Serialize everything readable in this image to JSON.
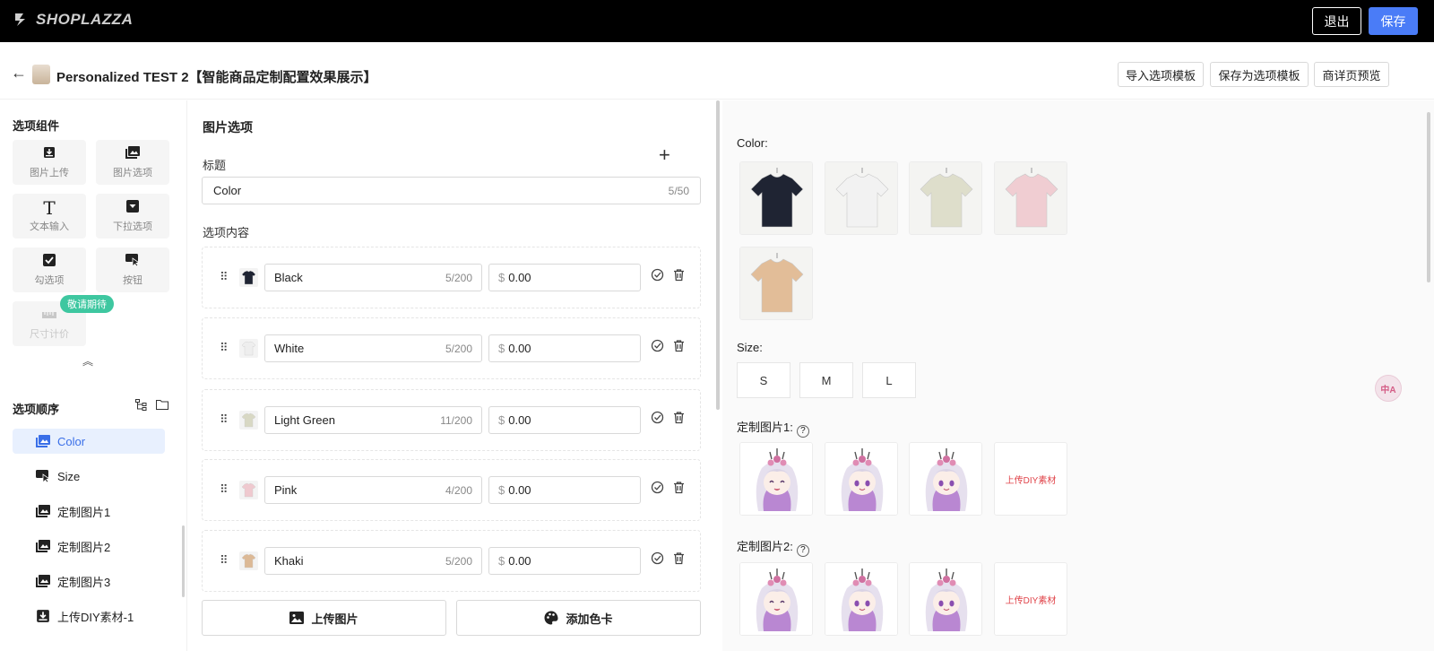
{
  "topbar": {
    "brand": "SHOPLAZZA",
    "exit_label": "退出",
    "save_label": "保存"
  },
  "header": {
    "title": "Personalized TEST 2【智能商品定制配置效果展示】",
    "import_template": "导入选项模板",
    "save_template": "保存为选项模板",
    "preview": "商详页预览"
  },
  "components": {
    "title": "选项组件",
    "items": [
      {
        "label": "图片上传",
        "icon": "image-upload-icon"
      },
      {
        "label": "图片选项",
        "icon": "image-option-icon"
      },
      {
        "label": "文本输入",
        "icon": "text-input-icon"
      },
      {
        "label": "下拉选项",
        "icon": "dropdown-icon"
      },
      {
        "label": "勾选项",
        "icon": "checkbox-icon"
      },
      {
        "label": "按钮",
        "icon": "button-cursor-icon"
      },
      {
        "label": "尺寸计价",
        "icon": "ruler-icon",
        "disabled": true
      }
    ],
    "coming_soon": "敬请期待"
  },
  "order": {
    "title": "选项顺序",
    "items": [
      {
        "label": "Color",
        "active": true
      },
      {
        "label": "Size"
      },
      {
        "label": "定制图片1"
      },
      {
        "label": "定制图片2"
      },
      {
        "label": "定制图片3"
      },
      {
        "label": "上传DIY素材-1"
      }
    ]
  },
  "editor": {
    "section_title": "图片选项",
    "title_label": "标题",
    "title_value": "Color",
    "title_counter": "5/50",
    "options_label": "选项内容",
    "options": [
      {
        "name": "Black",
        "counter": "5/200",
        "currency": "$",
        "price": "0.00",
        "color": "#1f2433"
      },
      {
        "name": "White",
        "counter": "5/200",
        "currency": "$",
        "price": "0.00",
        "color": "#eeeeee"
      },
      {
        "name": "Light Green",
        "counter": "11/200",
        "currency": "$",
        "price": "0.00",
        "color": "#d8d8c4"
      },
      {
        "name": "Pink",
        "counter": "4/200",
        "currency": "$",
        "price": "0.00",
        "color": "#efc9cf"
      },
      {
        "name": "Khaki",
        "counter": "5/200",
        "currency": "$",
        "price": "0.00",
        "color": "#dcb996"
      }
    ],
    "upload_image": "上传图片",
    "add_color_card": "添加色卡"
  },
  "preview": {
    "color_label": "Color:",
    "color_swatches": [
      "#1f2433",
      "#f2f2f2",
      "#dedecb",
      "#f0cdd2",
      "#e2bd98"
    ],
    "size_label": "Size:",
    "sizes": [
      "S",
      "M",
      "L"
    ],
    "custom1_label": "定制图片1:",
    "custom2_label": "定制图片2:",
    "diy_label": "上传DIY素材",
    "help_glyph": "?"
  },
  "fab": {
    "label": "中A"
  }
}
